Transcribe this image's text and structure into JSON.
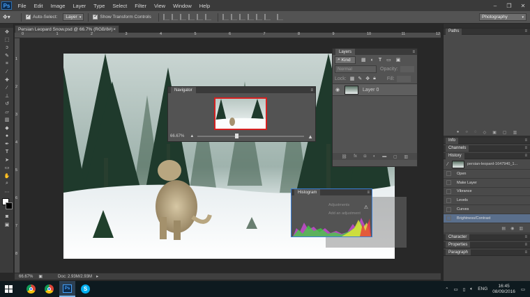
{
  "app": {
    "logo_text": "Ps",
    "menu": [
      "File",
      "Edit",
      "Image",
      "Layer",
      "Type",
      "Select",
      "Filter",
      "View",
      "Window",
      "Help"
    ],
    "window_controls": [
      "–",
      "❐",
      "✕"
    ]
  },
  "options": {
    "auto_select_label": "Auto-Select:",
    "auto_select_value": "Layer",
    "show_transform_label": "Show Transform Controls",
    "workspace": "Photography"
  },
  "document": {
    "tab_title": "Persian Leopard Snow.psd @ 66.7% (RGB/8#)",
    "tab_close": "×",
    "ruler_marks": [
      "0",
      "1",
      "2",
      "3",
      "4",
      "5",
      "6",
      "7",
      "8",
      "9",
      "10",
      "11",
      "12"
    ],
    "vruler_marks": [
      "1",
      "2",
      "3",
      "4",
      "5",
      "6",
      "7",
      "8"
    ],
    "zoom": "66.67%",
    "doc_size": "Doc: 2.93M/2.93M"
  },
  "layers_panel": {
    "title": "Layers",
    "kind_label": "Kind",
    "blend_mode": "Normal",
    "opacity_label": "Opacity:",
    "lock_label": "Lock:",
    "fill_label": "Fill:",
    "layer_name": "Layer 0",
    "footer_icons": [
      "link-icon",
      "fx-icon",
      "mask-icon",
      "adjustment-icon",
      "folder-icon",
      "new-layer-icon",
      "trash-icon"
    ]
  },
  "navigator_panel": {
    "title": "Navigator",
    "zoom": "66.67%",
    "zoom_fraction": 0.35
  },
  "histogram_panel": {
    "title": "Histogram",
    "adjustments_label": "Adjustments",
    "add_adjustment": "Add an adjustment"
  },
  "dock": {
    "paths_title": "Paths",
    "info_title": "Info",
    "channels_title": "Channels",
    "history_title": "History",
    "history_snapshot": "persian-leopard-1647940_1...",
    "history_items": [
      "Open",
      "Make Layer",
      "Vibrance",
      "Levels",
      "Curves",
      "Brightness/Contrast"
    ],
    "history_selected_index": 5,
    "character_title": "Character",
    "properties_title": "Properties",
    "paragraph_title": "Paragraph"
  },
  "taskbar": {
    "time": "16:45",
    "date": "08/09/2016",
    "language": "ENG"
  },
  "colors": {
    "accent_blue": "#45a3ff",
    "history_selected": "#5a6f8c"
  }
}
